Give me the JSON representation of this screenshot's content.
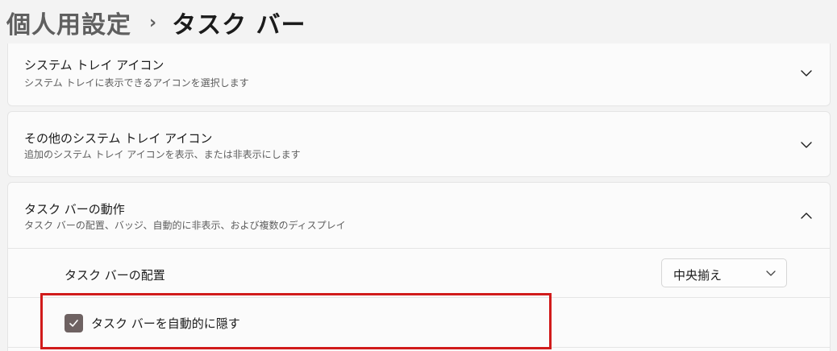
{
  "breadcrumb": {
    "parent": "個人用設定",
    "separator": "›",
    "current": "タスク バー"
  },
  "sections": [
    {
      "title": "システム トレイ アイコン",
      "description": "システム トレイに表示できるアイコンを選択します",
      "expanded": false,
      "chevron_icon": "chevron-down-icon"
    },
    {
      "title": "その他のシステム トレイ アイコン",
      "description": "追加のシステム トレイ アイコンを表示、または非表示にします",
      "expanded": false,
      "chevron_icon": "chevron-down-icon"
    },
    {
      "title": "タスク バーの動作",
      "description": "タスク バーの配置、バッジ、自動的に非表示、および複数のディスプレイ",
      "expanded": true,
      "chevron_icon": "chevron-up-icon"
    }
  ],
  "behaviors": {
    "alignment_label": "タスク バーの配置",
    "alignment_value": "中央揃え",
    "autohide_label": "タスク バーを自動的に隠す",
    "autohide_checked": true
  },
  "colors": {
    "checkbox_fill": "#6e6262",
    "highlight": "#d11b1b"
  }
}
